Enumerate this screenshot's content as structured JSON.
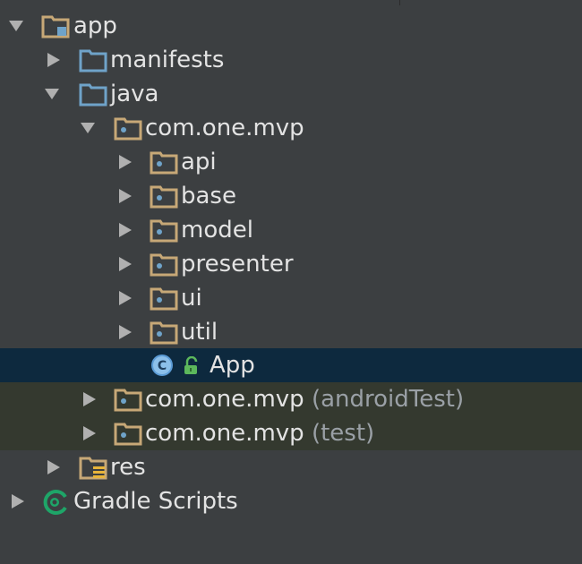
{
  "project_tree": {
    "app": {
      "label": "app"
    },
    "manifests": {
      "label": "manifests"
    },
    "java": {
      "label": "java"
    },
    "package_main": {
      "label": "com.one.mvp"
    },
    "api": {
      "label": "api"
    },
    "base": {
      "label": "base"
    },
    "model": {
      "label": "model"
    },
    "presenter": {
      "label": "presenter"
    },
    "ui": {
      "label": "ui"
    },
    "util": {
      "label": "util"
    },
    "app_class": {
      "label": "App",
      "selected": true
    },
    "package_android_test": {
      "label": "com.one.mvp",
      "suffix": "(androidTest)"
    },
    "package_test": {
      "label": "com.one.mvp",
      "suffix": "(test)"
    },
    "res": {
      "label": "res"
    },
    "gradle_scripts": {
      "label": "Gradle Scripts"
    }
  },
  "colors": {
    "background": "#3c3f41",
    "selection": "#0d293e",
    "test_tint": "#34392f",
    "folder": "#c7a877",
    "source_folder": "#6fa3c9",
    "class_icon": "#5b9bd5",
    "gradle": "#1ea568"
  }
}
